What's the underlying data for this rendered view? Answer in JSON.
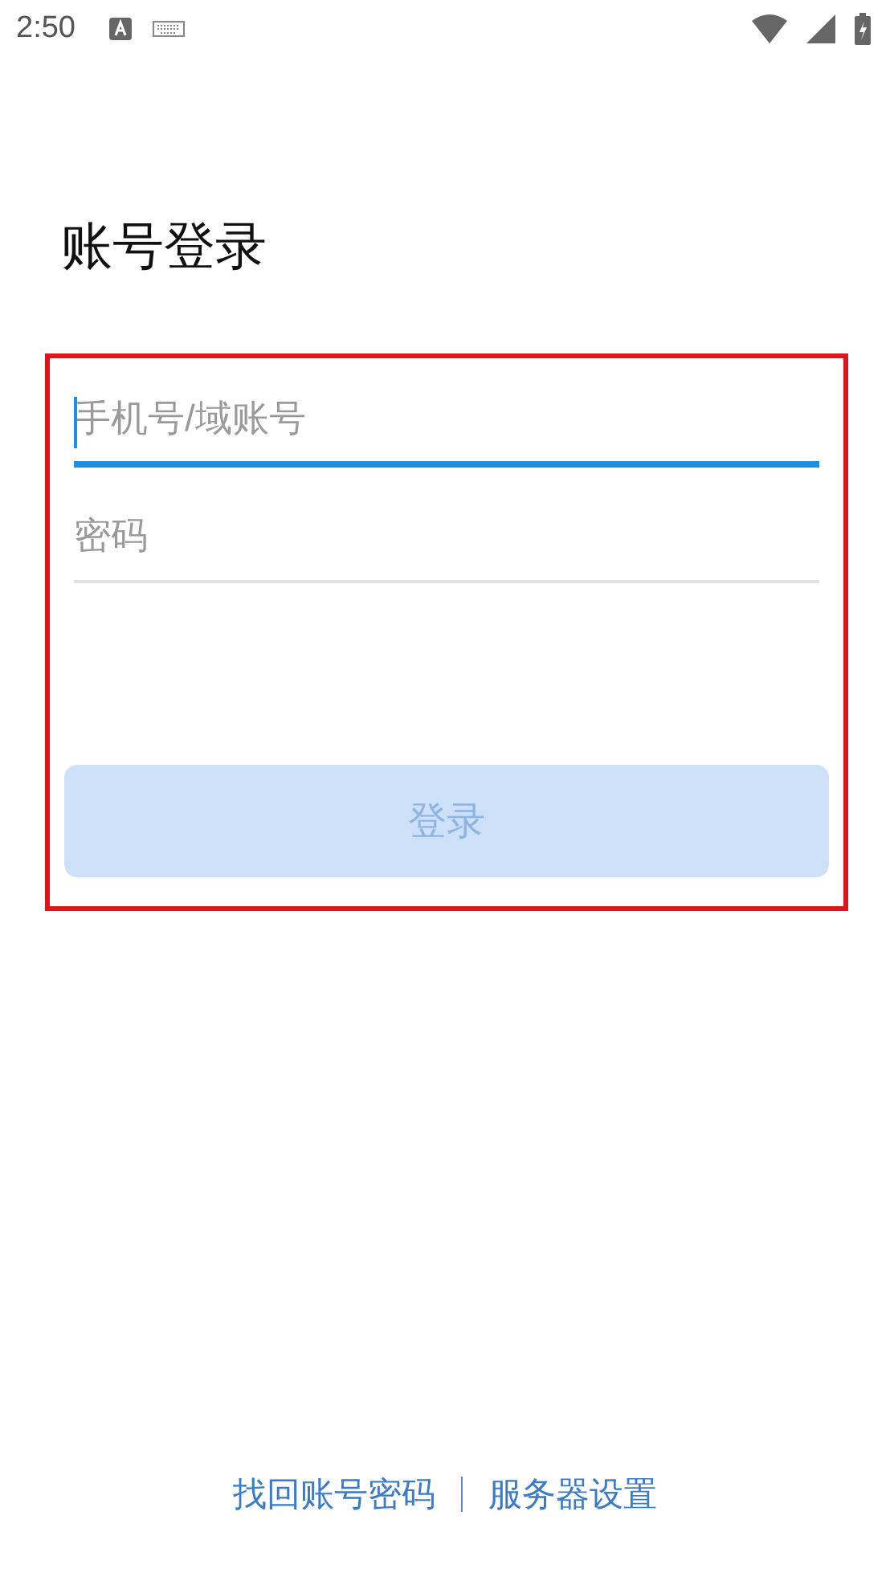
{
  "status_bar": {
    "time": "2:50"
  },
  "title": "账号登录",
  "fields": [
    {
      "placeholder": "手机号/域账号",
      "focused": true
    },
    {
      "placeholder": "密码",
      "focused": false
    }
  ],
  "login_button": {
    "label": "登录",
    "disabled": true
  },
  "footer_links": [
    "找回账号密码",
    "服务器设置"
  ]
}
